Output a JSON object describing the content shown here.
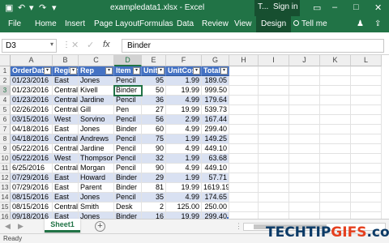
{
  "window": {
    "title": "exampledata1.xlsx - Excel",
    "table_tools_label": "T...",
    "sign_in": "Sign in"
  },
  "ribbon": {
    "tabs": [
      "File",
      "Home",
      "Insert",
      "Page Layout",
      "Formulas",
      "Data",
      "Review",
      "View",
      "Design"
    ],
    "active_tab": "Design",
    "tell_me": "Tell me"
  },
  "formula_bar": {
    "name_box": "D3",
    "cancel": "✕",
    "enter": "✓",
    "fx": "fx",
    "value": "Binder"
  },
  "grid": {
    "columns": [
      "A",
      "B",
      "C",
      "D",
      "E",
      "F",
      "G",
      "H",
      "I",
      "J",
      "K",
      "L"
    ],
    "selected_column": "D",
    "selected_row": 3,
    "row_numbers": [
      1,
      2,
      3,
      4,
      5,
      6,
      7,
      8,
      9,
      10,
      11,
      12,
      13,
      14,
      15,
      16
    ],
    "table_headers": [
      "OrderDate",
      "Region",
      "Rep",
      "Item",
      "Units",
      "UnitCost",
      "Total"
    ],
    "rows": [
      [
        "01/23/2016",
        "East",
        "Jones",
        "Pencil",
        "95",
        "1.99",
        "189.05"
      ],
      [
        "01/23/2016",
        "Central",
        "Kivell",
        "Binder",
        "50",
        "19.99",
        "999.50"
      ],
      [
        "01/23/2016",
        "Central",
        "Jardine",
        "Pencil",
        "36",
        "4.99",
        "179.64"
      ],
      [
        "02/26/2016",
        "Central",
        "Gill",
        "Pen",
        "27",
        "19.99",
        "539.73"
      ],
      [
        "03/15/2016",
        "West",
        "Sorvino",
        "Pencil",
        "56",
        "2.99",
        "167.44"
      ],
      [
        "04/18/2016",
        "East",
        "Jones",
        "Binder",
        "60",
        "4.99",
        "299.40"
      ],
      [
        "04/18/2016",
        "Central",
        "Andrews",
        "Pencil",
        "75",
        "1.99",
        "149.25"
      ],
      [
        "05/22/2016",
        "Central",
        "Jardine",
        "Pencil",
        "90",
        "4.99",
        "449.10"
      ],
      [
        "05/22/2016",
        "West",
        "Thompson",
        "Pencil",
        "32",
        "1.99",
        "63.68"
      ],
      [
        "6/25/2016",
        "Central",
        "Morgan",
        "Pencil",
        "90",
        "4.99",
        "449.10"
      ],
      [
        "07/29/2016",
        "East",
        "Howard",
        "Binder",
        "29",
        "1.99",
        "57.71"
      ],
      [
        "07/29/2016",
        "East",
        "Parent",
        "Binder",
        "81",
        "19.99",
        "1619.19"
      ],
      [
        "08/15/2016",
        "East",
        "Jones",
        "Pencil",
        "35",
        "4.99",
        "174.65"
      ],
      [
        "08/15/2016",
        "Central",
        "Smith",
        "Desk",
        "2",
        "125.00",
        "250.00"
      ],
      [
        "09/18/2016",
        "East",
        "Jones",
        "Binder",
        "16",
        "19.99",
        "299.40"
      ]
    ]
  },
  "sheets": {
    "tabs": [
      "Sheet1"
    ],
    "active": "Sheet1",
    "add_symbol": "+"
  },
  "status": {
    "text": "Ready"
  },
  "watermark": {
    "part1": "TECHTIP",
    "part2": "GIFS",
    "part3": ".com"
  },
  "colors": {
    "excel_green": "#217346",
    "table_header": "#4472c4",
    "table_band": "#d9e1f2"
  }
}
